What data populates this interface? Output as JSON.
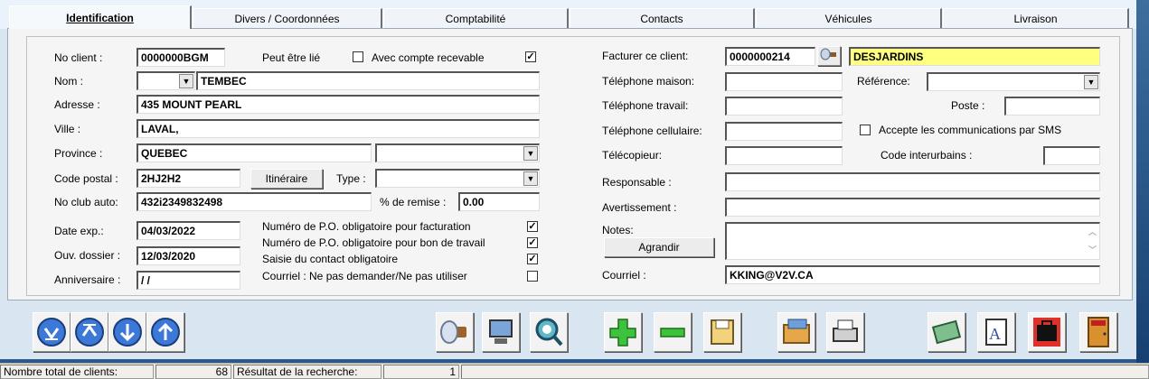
{
  "tabs": [
    "Identification",
    "Divers / Coordonnées",
    "Comptabilité",
    "Contacts",
    "Véhicules",
    "Livraison"
  ],
  "left": {
    "no_client_label": "No client :",
    "no_client_value": "0000000BGM",
    "peut_etre_lie_label": "Peut être lié",
    "avec_compte_label": "Avec compte recevable",
    "nom_label": "Nom :",
    "nom_value": "TEMBEC",
    "adresse_label": "Adresse :",
    "adresse_value": "435 MOUNT PEARL",
    "ville_label": "Ville :",
    "ville_value": "LAVAL,",
    "province_label": "Province :",
    "province_value": "QUEBEC",
    "code_postal_label": "Code postal :",
    "code_postal_value": "2HJ2H2",
    "itineraire_button": "Itinéraire",
    "type_label": "Type :",
    "club_label": "No club auto:",
    "club_value": "432i2349832498",
    "remise_label": "% de remise :",
    "remise_value": "0.00",
    "date_exp_label": "Date exp.:",
    "date_exp_value": "04/03/2022",
    "ouv_label": "Ouv. dossier :",
    "ouv_value": "12/03/2020",
    "anniv_label": "Anniversaire :",
    "anniv_value": " / /",
    "po_fact_label": "Numéro de P.O. obligatoire pour facturation",
    "po_bon_label": "Numéro de P.O. obligatoire pour bon de travail",
    "saisie_label": "Saisie du contact obligatoire",
    "courriel_ne_pas_label": "Courriel : Ne pas demander/Ne pas utiliser"
  },
  "right": {
    "facturer_label": "Facturer ce client:",
    "facturer_value": "0000000214",
    "facturer_name": "DESJARDINS",
    "tel_maison_label": "Téléphone maison:",
    "reference_label": "Référence:",
    "tel_travail_label": "Téléphone travail:",
    "poste_label": "Poste :",
    "tel_cell_label": "Téléphone cellulaire:",
    "sms_label": "Accepte les communications par SMS",
    "telecopieur_label": "Télécopieur:",
    "code_interurbains_label": "Code interurbains :",
    "responsable_label": "Responsable :",
    "avertissement_label": "Avertissement :",
    "notes_label": "Notes:",
    "agrandir_button": "Agrandir",
    "courriel_label": "Courriel :",
    "courriel_value": "KKING@V2V.CA"
  },
  "checkboxes": {
    "avec_compte": "✓",
    "po_fact": "✓",
    "po_bon": "✓",
    "saisie": "✓",
    "courriel_ne_pas": "",
    "sms": ""
  },
  "status": {
    "total_label": "Nombre total de clients:",
    "total_value": "68",
    "resultat_label": "Résultat de la recherche:",
    "resultat_value": "1"
  },
  "colors": {
    "highlight": "#ffff80",
    "nav_blue": "#3b78d8"
  }
}
